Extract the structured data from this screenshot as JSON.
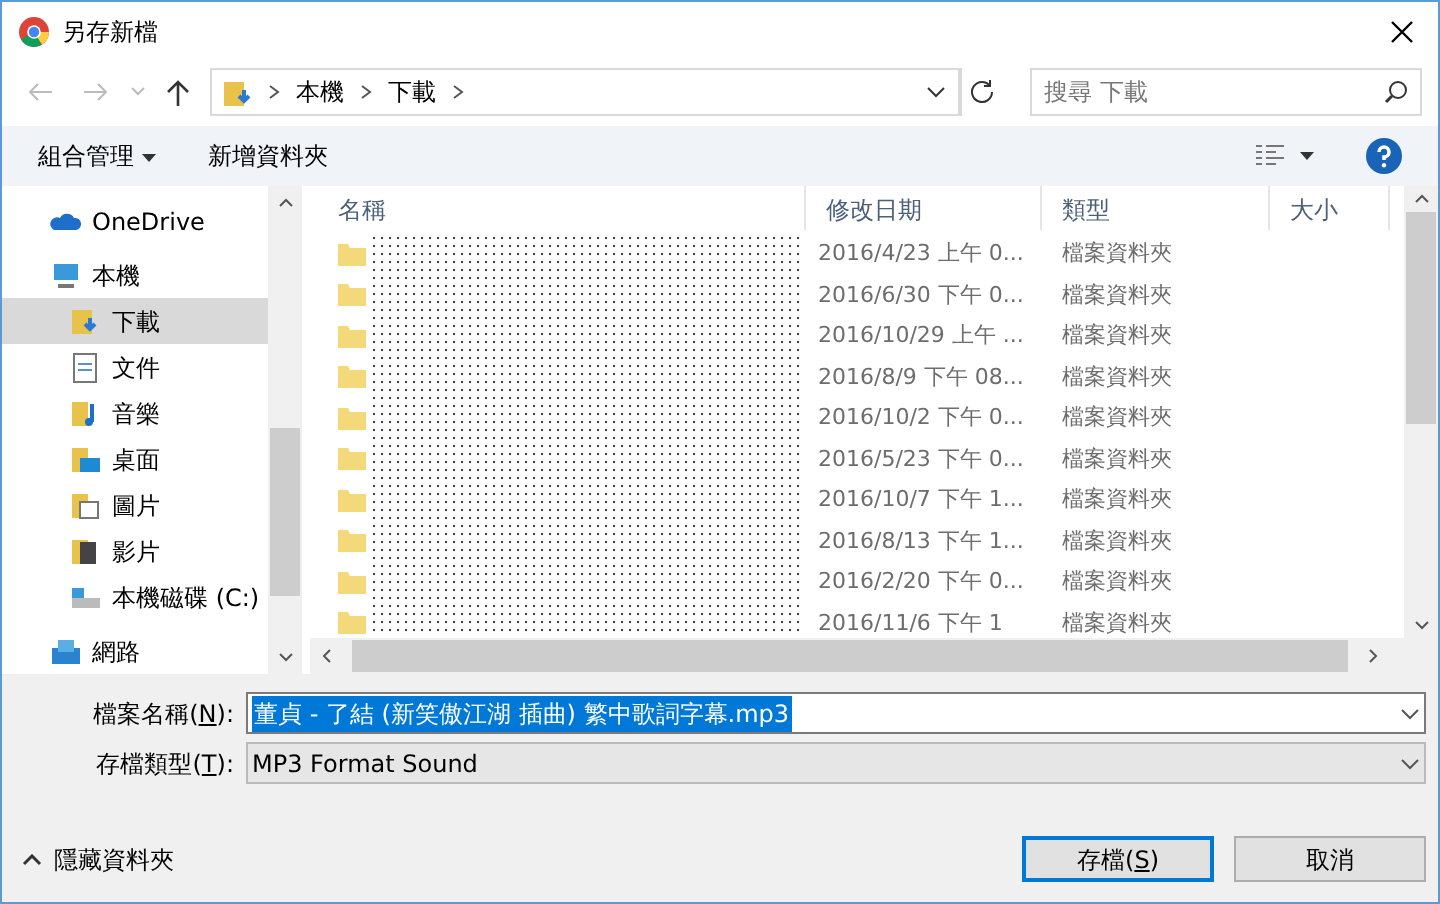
{
  "window": {
    "title": "另存新檔"
  },
  "address": {
    "crumbs": [
      "本機",
      "下載"
    ],
    "search_placeholder": "搜尋 下載"
  },
  "toolbar": {
    "organize": "組合管理",
    "new_folder": "新增資料夾"
  },
  "sidebar": {
    "items": [
      {
        "label": "OneDrive",
        "kind": "cloud",
        "selected": false
      },
      {
        "label": "本機",
        "kind": "pc",
        "selected": false,
        "children": [
          {
            "label": "下載",
            "kind": "download",
            "selected": true
          },
          {
            "label": "文件",
            "kind": "doc",
            "selected": false
          },
          {
            "label": "音樂",
            "kind": "music",
            "selected": false
          },
          {
            "label": "桌面",
            "kind": "desktop",
            "selected": false
          },
          {
            "label": "圖片",
            "kind": "picture",
            "selected": false
          },
          {
            "label": "影片",
            "kind": "video",
            "selected": false
          },
          {
            "label": "本機磁碟 (C:)",
            "kind": "drive",
            "selected": false
          }
        ]
      },
      {
        "label": "網路",
        "kind": "network",
        "selected": false
      }
    ]
  },
  "table": {
    "columns": [
      "名稱",
      "修改日期",
      "類型",
      "大小"
    ],
    "rows": [
      {
        "date": "2016/4/23 上午 0...",
        "type": "檔案資料夾"
      },
      {
        "date": "2016/6/30 下午 0...",
        "type": "檔案資料夾"
      },
      {
        "date": "2016/10/29 上午 ...",
        "type": "檔案資料夾"
      },
      {
        "date": "2016/8/9 下午 08...",
        "type": "檔案資料夾"
      },
      {
        "date": "2016/10/2 下午 0...",
        "type": "檔案資料夾"
      },
      {
        "date": "2016/5/23 下午 0...",
        "type": "檔案資料夾"
      },
      {
        "date": "2016/10/7 下午 1...",
        "type": "檔案資料夾"
      },
      {
        "date": "2016/8/13 下午 1...",
        "type": "檔案資料夾"
      },
      {
        "date": "2016/2/20 下午 0...",
        "type": "檔案資料夾"
      },
      {
        "date": "2016/11/6 下午 1",
        "type": "檔案資料夾"
      }
    ]
  },
  "filename": {
    "label_parts": [
      "檔案名稱(",
      "N",
      "):"
    ],
    "value": "董貞 - 了結 (新笑傲江湖 插曲) 繁中歌詞字幕.mp3"
  },
  "filetype": {
    "label_parts": [
      "存檔類型(",
      "T",
      "):"
    ],
    "value": "MP3 Format Sound"
  },
  "hide_folders": "隱藏資料夾",
  "buttons": [
    {
      "label_parts": [
        "存檔(",
        "S",
        ")"
      ],
      "kind": "default"
    },
    {
      "label_parts": [
        "取消"
      ],
      "kind": "normal"
    }
  ]
}
